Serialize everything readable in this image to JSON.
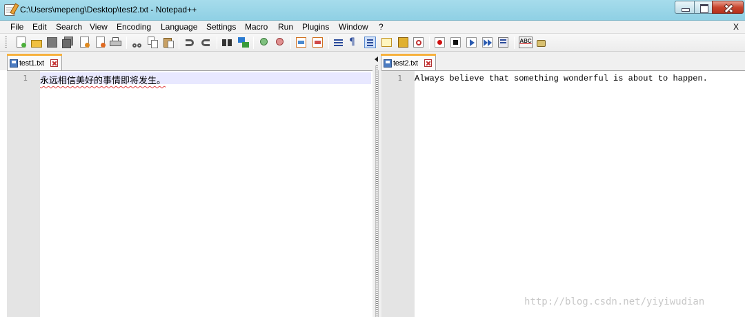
{
  "window": {
    "title": "C:\\Users\\mepeng\\Desktop\\test2.txt - Notepad++"
  },
  "menu": {
    "items": [
      "File",
      "Edit",
      "Search",
      "View",
      "Encoding",
      "Language",
      "Settings",
      "Macro",
      "Run",
      "Plugins",
      "Window",
      "?"
    ],
    "close_label": "X"
  },
  "toolbar": {
    "icons": [
      "new-file-icon",
      "open-file-icon",
      "save-icon",
      "save-all-icon",
      "close-icon",
      "close-all-icon",
      "print-icon",
      "cut-icon",
      "copy-icon",
      "paste-icon",
      "undo-icon",
      "redo-icon",
      "find-icon",
      "replace-icon",
      "zoom-in-icon",
      "zoom-out-icon",
      "sync-vertical-icon",
      "sync-horizontal-icon",
      "word-wrap-icon",
      "show-all-chars-icon",
      "indent-guide-icon",
      "user-language-icon",
      "doc-map-icon",
      "function-list-icon",
      "record-macro-icon",
      "stop-macro-icon",
      "play-macro-icon",
      "run-macro-multiple-icon",
      "save-macro-icon",
      "spell-check-icon",
      "tools-icon"
    ]
  },
  "left_view": {
    "tab_label": "test1.txt",
    "line_number": "1",
    "content": "永远相信美好的事情即将发生。"
  },
  "right_view": {
    "tab_label": "test2.txt",
    "line_number": "1",
    "content": "Always believe that something wonderful is about to happen."
  },
  "watermark": "http://blog.csdn.net/yiyiwudian",
  "colors": {
    "titlebar": "#9bd6e8",
    "active_tab_accent": "#f7b13d",
    "gutter": "#e4e4e4",
    "current_line": "#e8e8ff",
    "close_button": "#c9462f"
  }
}
